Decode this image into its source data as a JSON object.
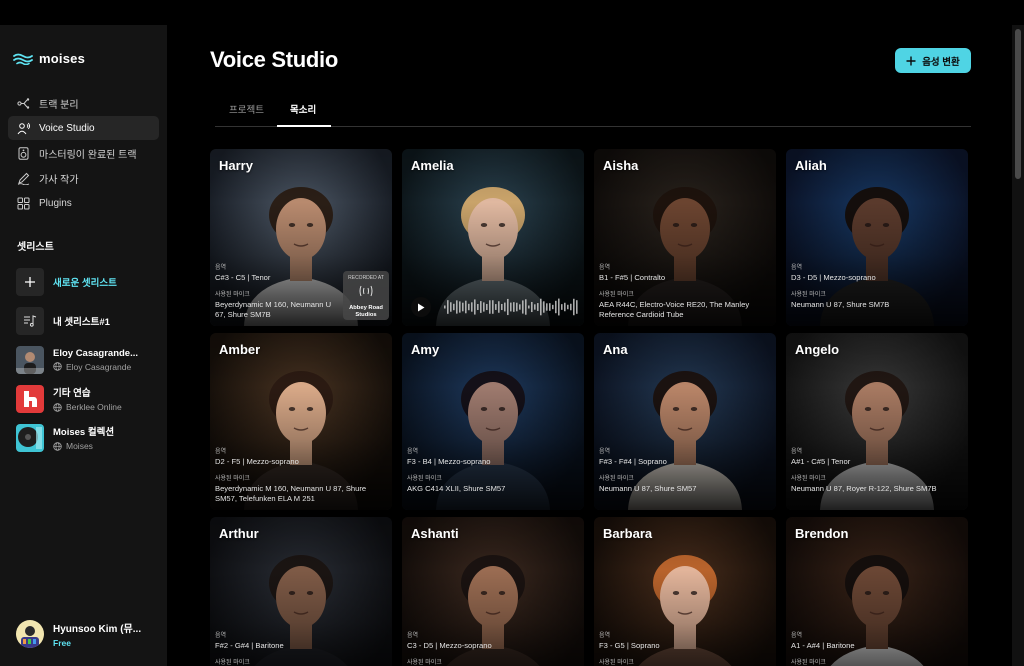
{
  "app": {
    "logo_text": "moises",
    "accent_color": "#5fe3f2"
  },
  "sidebar": {
    "nav": [
      {
        "label": "트랙 분리",
        "icon": "split-tracks-icon"
      },
      {
        "label": "Voice Studio",
        "icon": "voice-studio-icon",
        "active": true
      },
      {
        "label": "마스터링이 완료된 트랙",
        "icon": "speaker-icon"
      },
      {
        "label": "가사 작가",
        "icon": "lyrics-pen-icon"
      },
      {
        "label": "Plugins",
        "icon": "grid-icon"
      }
    ],
    "setlists_title": "셋리스트",
    "setlists": [
      {
        "title": "새로운 셋리스트",
        "sub": ""
      },
      {
        "title": "내 셋리스트#1",
        "sub": ""
      },
      {
        "title": "Eloy Casagrande...",
        "sub": "Eloy Casagrande"
      },
      {
        "title": "기타 연습",
        "sub": "Berklee Online"
      },
      {
        "title": "Moises 컬렉션",
        "sub": "Moises"
      }
    ],
    "user": {
      "name": "Hyunsoo Kim (뮤...",
      "plan": "Free"
    }
  },
  "main": {
    "title": "Voice Studio",
    "cta_label": "음성 변환",
    "tabs": [
      {
        "label": "프로젝트",
        "active": false
      },
      {
        "label": "목소리",
        "active": true
      }
    ],
    "range_label": "음역",
    "mic_label": "사용된 마이크",
    "badge": {
      "top": "RECORDED AT",
      "bottom": "Abbey Road Studios"
    },
    "voices": [
      {
        "name": "Harry",
        "range": "C#3 - C5 | Tenor",
        "mics": "Beyerdynamic M 160, Neumann U 67, Shure SM7B",
        "bg1": "#4f5a68",
        "bg2": "#171c24",
        "skin": "#b88a6e",
        "hair": "#2a1e16",
        "shirt": "#d9d9d9",
        "badge": true
      },
      {
        "name": "Amelia",
        "range": "",
        "mics": "",
        "bg1": "#2c4452",
        "bg2": "#0c1519",
        "skin": "#e0b8a0",
        "hair": "#c9a36a",
        "shirt": "#6c7a80",
        "player": true
      },
      {
        "name": "Aisha",
        "range": "B1 - F#5 | Contralto",
        "mics": "AEA R44C, Electro-Voice RE20, The Manley Reference Cardioid Tube",
        "bg1": "#2b241e",
        "bg2": "#0e0b09",
        "skin": "#6b4430",
        "hair": "#1d120c",
        "shirt": "#2a2422"
      },
      {
        "name": "Aliah",
        "range": "D3 - D5 | Mezzo-soprano",
        "mics": "Neumann U 87, Shure SM7B",
        "bg1": "#183a66",
        "bg2": "#0a1226",
        "skin": "#5a3a2c",
        "hair": "#140e0c",
        "shirt": "#242424"
      },
      {
        "name": "Amber",
        "range": "D2 - F5 | Mezzo-soprano",
        "mics": "Beyerdynamic M 160, Neumann U 87, Shure SM57, Telefunken ELA M 251",
        "bg1": "#4a3422",
        "bg2": "#140e09",
        "skin": "#d9a988",
        "hair": "#2b1a12",
        "shirt": "#3a2e28"
      },
      {
        "name": "Amy",
        "range": "F3 - B4 | Mezzo-soprano",
        "mics": "AKG C414 XLII, Shure SM57",
        "bg1": "#1f3b60",
        "bg2": "#09121f",
        "skin": "#9e7a6e",
        "hair": "#141018",
        "shirt": "#2b3d55"
      },
      {
        "name": "Ana",
        "range": "F#3 - F#4 | Soprano",
        "mics": "Neumann U 87, Shure SM57",
        "bg1": "#243a55",
        "bg2": "#0b1220",
        "skin": "#b98568",
        "hair": "#1b1210",
        "shirt": "#e6e0d6"
      },
      {
        "name": "Angelo",
        "range": "A#1 - C#5 | Tenor",
        "mics": "Neumann U 87, Royer R-122, Shure SM7B",
        "bg1": "#3a3a3a",
        "bg2": "#121212",
        "skin": "#a87a62",
        "hair": "#201612",
        "shirt": "#d6d6d6"
      },
      {
        "name": "Arthur",
        "range": "F#2 - G#4 | Baritone",
        "mics": "",
        "bg1": "#2a2e36",
        "bg2": "#0c0d10",
        "skin": "#7e5a46",
        "hair": "#1a1412",
        "shirt": "#1e2026"
      },
      {
        "name": "Ashanti",
        "range": "C3 - D5 | Mezzo-soprano",
        "mics": "",
        "bg1": "#3d2a20",
        "bg2": "#120c09",
        "skin": "#9a6c52",
        "hair": "#1a1210",
        "shirt": "#3a2a22"
      },
      {
        "name": "Barbara",
        "range": "F3 - G5 | Soprano",
        "mics": "",
        "bg1": "#4a2e1c",
        "bg2": "#150d08",
        "skin": "#e2b49a",
        "hair": "#b8632c",
        "shirt": "#6a4a3a"
      },
      {
        "name": "Brendon",
        "range": "A1 - A#4 | Baritone",
        "mics": "",
        "bg1": "#3a2418",
        "bg2": "#120b08",
        "skin": "#6a4634",
        "hair": "#140e0c",
        "shirt": "#d8d8d8"
      }
    ]
  }
}
